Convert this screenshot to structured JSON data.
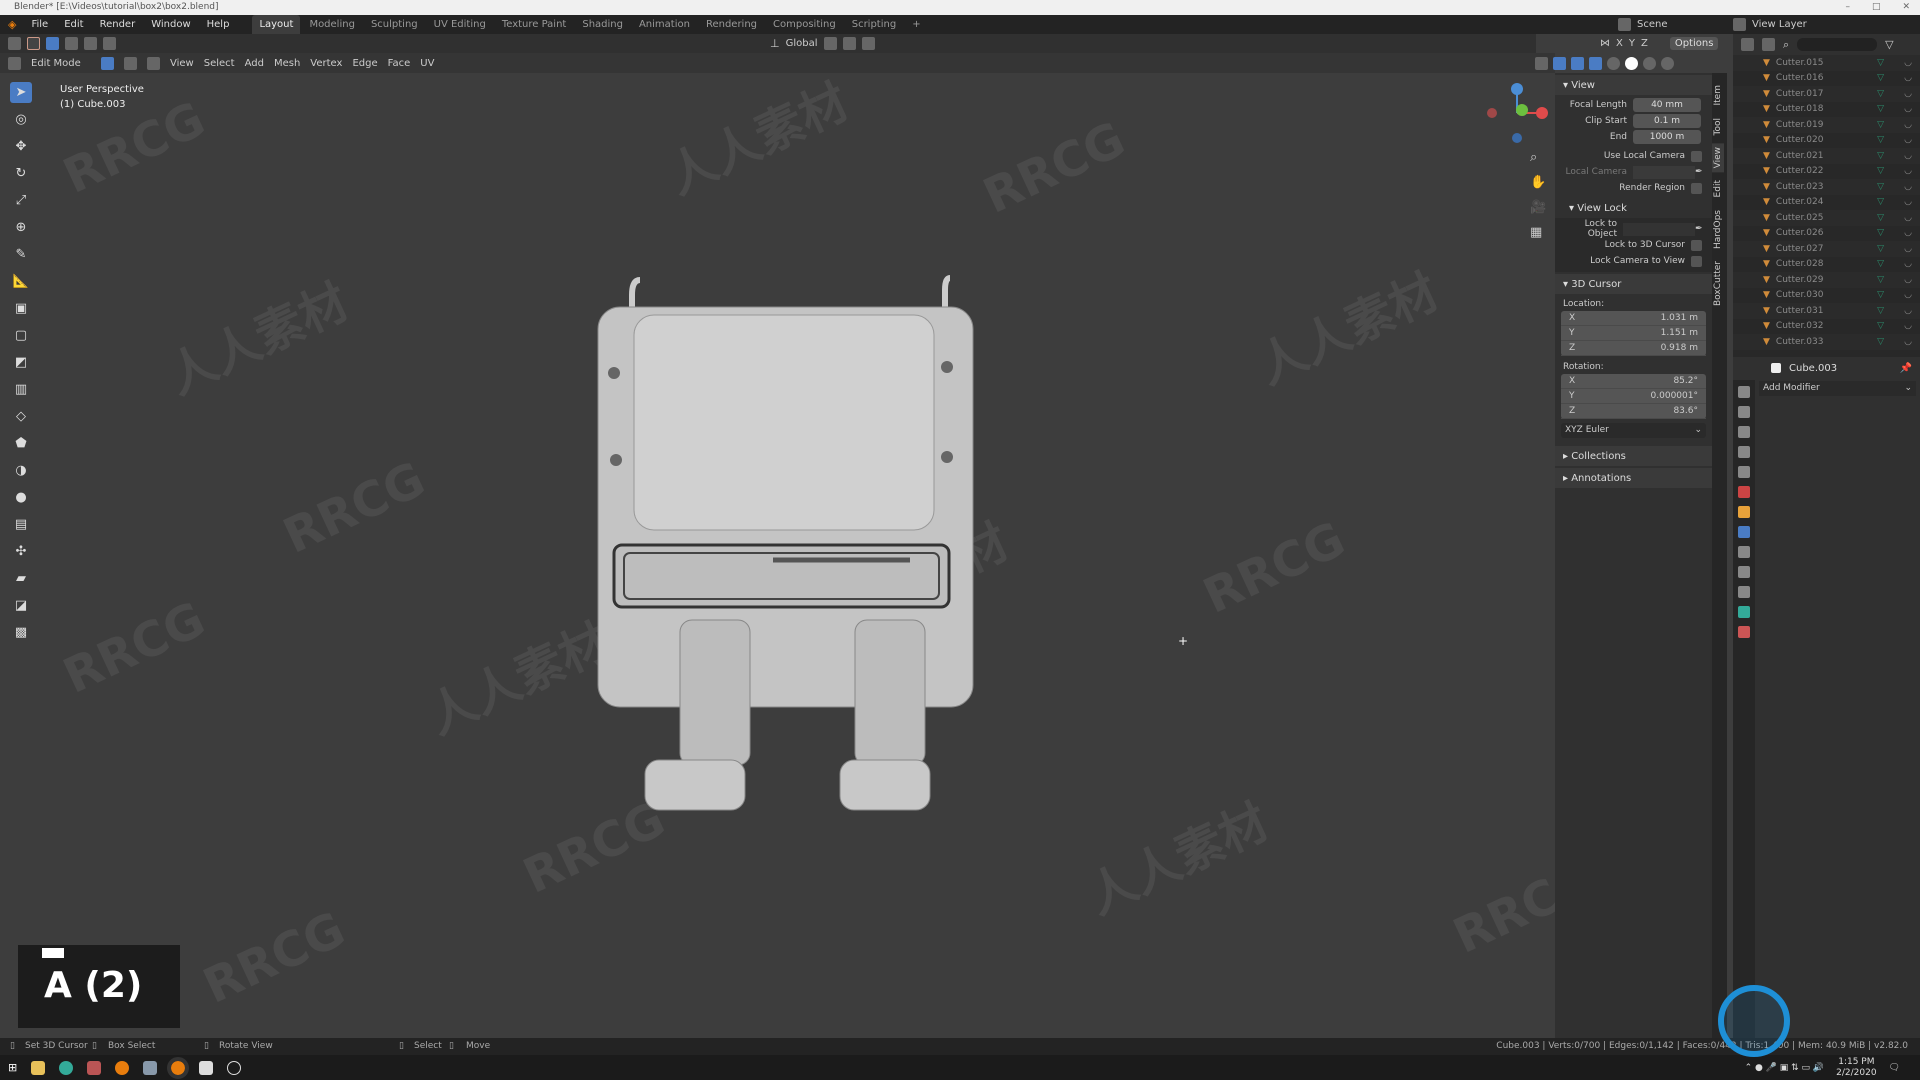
{
  "window": {
    "title": "Blender* [E:\\Videos\\tutorial\\box2\\box2.blend]",
    "controls": [
      "–",
      "□",
      "✕"
    ]
  },
  "menus": [
    "File",
    "Edit",
    "Render",
    "Window",
    "Help"
  ],
  "workspaces": [
    "Layout",
    "Modeling",
    "Sculpting",
    "UV Editing",
    "Texture Paint",
    "Shading",
    "Animation",
    "Rendering",
    "Compositing",
    "Scripting",
    "+"
  ],
  "active_workspace": "Layout",
  "scene": {
    "label": "Scene",
    "view_layer": "View Layer"
  },
  "tool_header": {
    "orientation": "Global",
    "axes": [
      "X",
      "Y",
      "Z"
    ],
    "options": "Options"
  },
  "view_header": {
    "mode": "Edit Mode",
    "menus": [
      "View",
      "Select",
      "Add",
      "Mesh",
      "Vertex",
      "Edge",
      "Face",
      "UV"
    ]
  },
  "viewport": {
    "perspective": "User Perspective",
    "object": "(1) Cube.003"
  },
  "npanel": {
    "view_title": "View",
    "focal_length": {
      "label": "Focal Length",
      "value": "40 mm"
    },
    "clip_start": {
      "label": "Clip Start",
      "value": "0.1 m"
    },
    "clip_end": {
      "label": "End",
      "value": "1000 m"
    },
    "use_local_camera": "Use Local Camera",
    "local_camera": "Local Camera",
    "render_region": "Render Region",
    "view_lock_title": "View Lock",
    "lock_to_object": "Lock to Object",
    "lock_to_cursor": "Lock to 3D Cursor",
    "lock_camera": "Lock Camera to View",
    "cursor_title": "3D Cursor",
    "location_label": "Location:",
    "location": [
      {
        "axis": "X",
        "value": "1.031 m"
      },
      {
        "axis": "Y",
        "value": "1.151 m"
      },
      {
        "axis": "Z",
        "value": "0.918 m"
      }
    ],
    "rotation_label": "Rotation:",
    "rotation": [
      {
        "axis": "X",
        "value": "85.2°"
      },
      {
        "axis": "Y",
        "value": "0.000001°"
      },
      {
        "axis": "Z",
        "value": "83.6°"
      }
    ],
    "rotation_mode": "XYZ Euler",
    "collections": "Collections",
    "annotations": "Annotations",
    "tabs": [
      "Item",
      "Tool",
      "View",
      "Edit",
      "HardOps",
      "BoxCutter"
    ],
    "active_tab": "View"
  },
  "outliner": {
    "items": [
      "Cutter.015",
      "Cutter.016",
      "Cutter.017",
      "Cutter.018",
      "Cutter.019",
      "Cutter.020",
      "Cutter.021",
      "Cutter.022",
      "Cutter.023",
      "Cutter.024",
      "Cutter.025",
      "Cutter.026",
      "Cutter.027",
      "Cutter.028",
      "Cutter.029",
      "Cutter.030",
      "Cutter.031",
      "Cutter.032",
      "Cutter.033"
    ]
  },
  "properties": {
    "object": "Cube.003",
    "add_modifier": "Add Modifier"
  },
  "statusbar": {
    "hints": [
      "Set 3D Cursor",
      "Box Select",
      "Rotate View",
      "Select",
      "Move"
    ],
    "stats": "Cube.003 | Verts:0/700 | Edges:0/1,142 | Faces:0/442 | Tris:1,400 | Mem: 40.9 MiB | v2.82.0"
  },
  "taskbar": {
    "time": "1:15 PM",
    "date": "2/2/2020"
  },
  "keys_overlay": "A (2)",
  "watermark": [
    "RRCG",
    "人人素材"
  ],
  "colors": {
    "accent": "#4a7cc4",
    "viewport": "#3d3d3d",
    "object_icon": "#d08b3a"
  }
}
